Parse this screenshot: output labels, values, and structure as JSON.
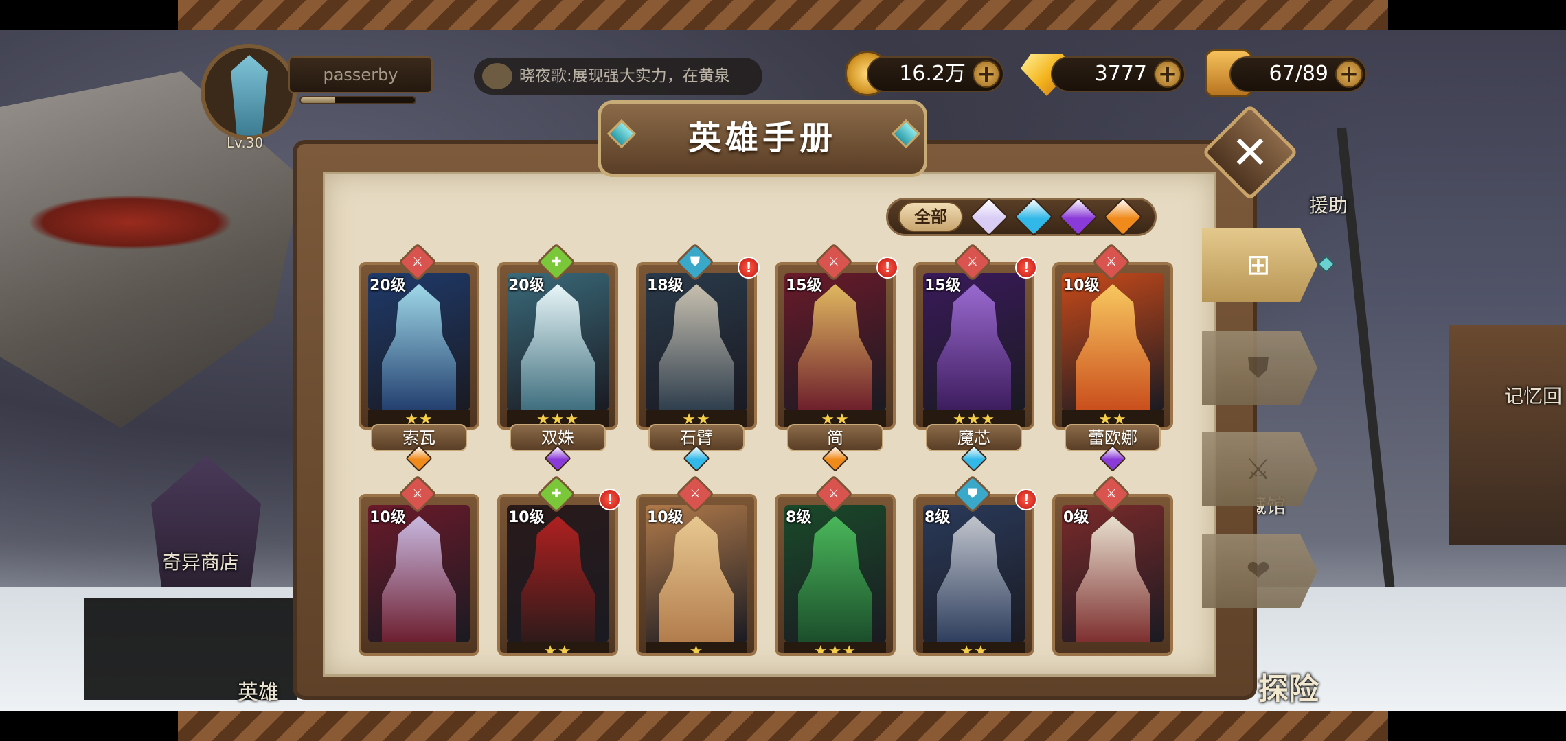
{
  "player": {
    "name": "passerby",
    "level": "Lv.30",
    "exp_progress": 0.3
  },
  "chat": {
    "message": "晓夜歌:展现强大实力，在黄泉"
  },
  "currencies": [
    {
      "name": "gold",
      "value": "16.2万",
      "icon": "gold-coin-icon",
      "plus": "+"
    },
    {
      "name": "diamonds",
      "value": "3777",
      "icon": "diamond-icon",
      "plus": "+"
    },
    {
      "name": "stamina",
      "value": "67/89",
      "icon": "treasure-chest-icon",
      "plus": "+"
    }
  ],
  "background_labels": {
    "shop": "奇异商店",
    "hero": "英雄",
    "assist": "援助",
    "memory": "记忆回",
    "museum": "藏馆",
    "adventure": "探险"
  },
  "panel": {
    "title": "英雄手册",
    "close": "✕"
  },
  "filters": {
    "all_label": "全部",
    "factions": [
      {
        "icon": "light-faction-icon",
        "color": "#d9cdf5"
      },
      {
        "icon": "water-faction-icon",
        "color": "#32b8e8"
      },
      {
        "icon": "dark-faction-icon",
        "color": "#8a3ad8"
      },
      {
        "icon": "fire-faction-icon",
        "color": "#f08a1a"
      }
    ]
  },
  "side_tabs": [
    {
      "icon": "all-grid-icon",
      "glyph": "⊞",
      "active": true
    },
    {
      "icon": "shield-icon",
      "glyph": "⛊",
      "active": false
    },
    {
      "icon": "sword-icon",
      "glyph": "⚔",
      "active": false
    },
    {
      "icon": "heart-icon",
      "glyph": "❤",
      "active": false
    }
  ],
  "heroes": [
    {
      "name": "索瓦",
      "level": "20级",
      "stars": "★★",
      "role": "warrior",
      "role_glyph": "⚔",
      "role_color": "#d9534f",
      "faction": "fire",
      "faction_color": "#f08a1a",
      "alert": "",
      "art": [
        "#1f3a6a",
        "#9fd8e8"
      ]
    },
    {
      "name": "双姝",
      "level": "20级",
      "stars": "★★★",
      "role": "support",
      "role_glyph": "✚",
      "role_color": "#7ac83a",
      "faction": "dark",
      "faction_color": "#8a3ad8",
      "alert": "",
      "art": [
        "#3a6a7a",
        "#e8f6f8"
      ]
    },
    {
      "name": "石臂",
      "level": "18级",
      "stars": "★★",
      "role": "tank",
      "role_glyph": "⛊",
      "role_color": "#3aa8c8",
      "faction": "water",
      "faction_color": "#32b8e8",
      "alert": "!",
      "art": [
        "#2a3a4a",
        "#c8c0b0"
      ]
    },
    {
      "name": "简",
      "level": "15级",
      "stars": "★★",
      "role": "warrior",
      "role_glyph": "⚔",
      "role_color": "#d9534f",
      "faction": "fire",
      "faction_color": "#f08a1a",
      "alert": "!",
      "art": [
        "#6a1a2a",
        "#e0b860"
      ]
    },
    {
      "name": "魔芯",
      "level": "15级",
      "stars": "★★★",
      "role": "warrior",
      "role_glyph": "⚔",
      "role_color": "#d9534f",
      "faction": "water",
      "faction_color": "#32b8e8",
      "alert": "!",
      "art": [
        "#3a1a5a",
        "#9a6ad0"
      ]
    },
    {
      "name": "蕾欧娜",
      "level": "10级",
      "stars": "★★",
      "role": "warrior",
      "role_glyph": "⚔",
      "role_color": "#d9534f",
      "faction": "dark",
      "faction_color": "#8a3ad8",
      "alert": "",
      "art": [
        "#c84a1a",
        "#f8c860"
      ]
    },
    {
      "name": "",
      "level": "10级",
      "stars": "",
      "role": "warrior",
      "role_glyph": "⚔",
      "role_color": "#d9534f",
      "faction": "",
      "faction_color": "",
      "alert": "",
      "art": [
        "#6a1a2a",
        "#c8b8e0"
      ]
    },
    {
      "name": "",
      "level": "10级",
      "stars": "★★",
      "role": "support",
      "role_glyph": "✚",
      "role_color": "#7ac83a",
      "faction": "",
      "faction_color": "",
      "alert": "!",
      "art": [
        "#2a1a1a",
        "#b02020"
      ]
    },
    {
      "name": "",
      "level": "10级",
      "stars": "★",
      "role": "warrior",
      "role_glyph": "⚔",
      "role_color": "#d9534f",
      "faction": "",
      "faction_color": "",
      "alert": "",
      "art": [
        "#b07a4a",
        "#e8c890"
      ]
    },
    {
      "name": "",
      "level": "8级",
      "stars": "★★★",
      "role": "warrior",
      "role_glyph": "⚔",
      "role_color": "#d9534f",
      "faction": "",
      "faction_color": "",
      "alert": "",
      "art": [
        "#1a4a2a",
        "#4ab85a"
      ]
    },
    {
      "name": "",
      "level": "8级",
      "stars": "★★",
      "role": "tank",
      "role_glyph": "⛊",
      "role_color": "#3aa8c8",
      "faction": "",
      "faction_color": "",
      "alert": "!",
      "art": [
        "#2a3a5a",
        "#c0c4cc"
      ]
    },
    {
      "name": "",
      "level": "0级",
      "stars": "",
      "role": "warrior",
      "role_glyph": "⚔",
      "role_color": "#d9534f",
      "faction": "",
      "faction_color": "",
      "alert": "",
      "art": [
        "#7a2a2a",
        "#e8e0d0"
      ]
    }
  ]
}
